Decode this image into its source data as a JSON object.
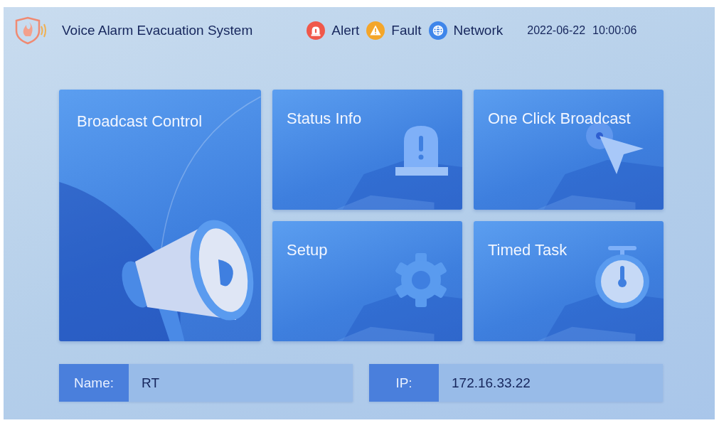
{
  "header": {
    "title": "Voice Alarm Evacuation System",
    "indicators": [
      {
        "kind": "alert",
        "label": "Alert",
        "color": "#f0584a"
      },
      {
        "kind": "fault",
        "label": "Fault",
        "color": "#f4a62a"
      },
      {
        "kind": "network",
        "label": "Network",
        "color": "#3f86ea"
      }
    ],
    "date": "2022-06-22",
    "time": "10:00:06"
  },
  "tiles": [
    {
      "kind": "megaphone",
      "label": "Broadcast Control"
    },
    {
      "kind": "alarm",
      "label": "Status Info"
    },
    {
      "kind": "pointer",
      "label": "One Click Broadcast"
    },
    {
      "kind": "gear",
      "label": "Setup"
    },
    {
      "kind": "stopwatch",
      "label": "Timed Task"
    }
  ],
  "info": [
    {
      "label": "Name:",
      "value": "RT"
    },
    {
      "label": "IP:",
      "value": "172.16.33.22"
    }
  ]
}
